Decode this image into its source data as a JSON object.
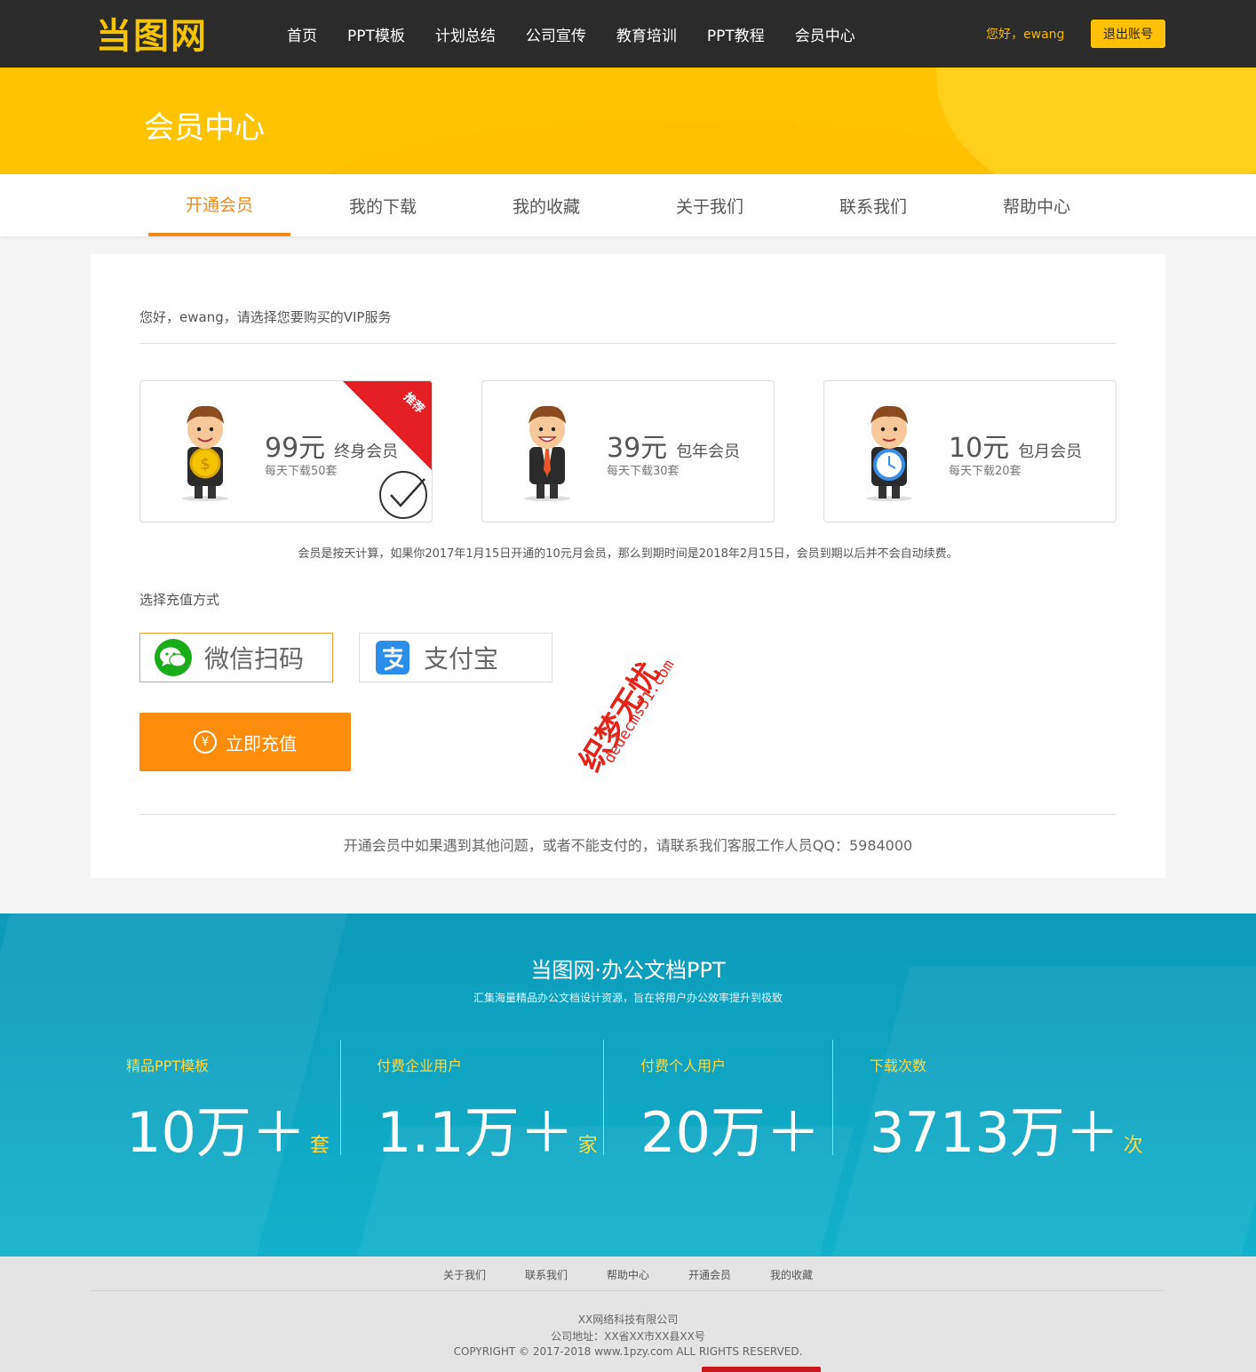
{
  "brand": {
    "logo_text": "当图网",
    "accent": "#f5c400",
    "orange": "#f08b1a"
  },
  "nav": {
    "items": [
      "首页",
      "PPT模板",
      "计划总结",
      "公司宣传",
      "教育培训",
      "PPT教程",
      "会员中心"
    ],
    "greeting": "您好，ewang",
    "logout": "退出账号"
  },
  "banner": {
    "title": "会员中心"
  },
  "tabs": [
    "开通会员",
    "我的下载",
    "我的收藏",
    "关于我们",
    "联系我们",
    "帮助中心"
  ],
  "main": {
    "hello": "您好，ewang，请选择您要购买的VIP服务",
    "plans": [
      {
        "price": "99元",
        "type": "终身会员",
        "desc": "每天下载50套",
        "ribbon": "推荐",
        "selected": true,
        "icon": "coin-mascot-icon"
      },
      {
        "price": "39元",
        "type": "包年会员",
        "desc": "每天下载30套",
        "icon": "tie-mascot-icon"
      },
      {
        "price": "10元",
        "type": "包月会员",
        "desc": "每天下载20套",
        "icon": "clock-mascot-icon"
      }
    ],
    "note": "会员是按天计算，如果你2017年1月15日开通的10元月会员，那么到期时间是2018年2月15日，会员到期以后并不会自动续费。",
    "pay_label": "选择充值方式",
    "pay_methods": [
      {
        "label": "微信扫码",
        "icon": "wechat-icon",
        "selected": true
      },
      {
        "label": "支付宝",
        "icon": "alipay-icon"
      }
    ],
    "recharge": "立即充值",
    "recharge_symbol": "¥",
    "contact": "开通会员中如果遇到其他问题，或者不能支付的，请联系我们客服工作人员QQ：5984000",
    "watermark": {
      "cn": "织梦无忧",
      "url": "dedecms51.com"
    }
  },
  "stats": {
    "title": "当图网·办公文档PPT",
    "subtitle": "汇集海量精品办公文档设计资源，旨在将用户办公效率提升到极致",
    "items": [
      {
        "label": "精品PPT模板",
        "value": "10万＋",
        "unit": "套"
      },
      {
        "label": "付费企业用户",
        "value": "1.1万＋",
        "unit": "家"
      },
      {
        "label": "付费个人用户",
        "value": "20万＋",
        "unit": ""
      },
      {
        "label": "下载次数",
        "value": "3713万＋",
        "unit": "次"
      }
    ]
  },
  "footer": {
    "links": [
      "关于我们",
      "联系我们",
      "帮助中心",
      "开通会员",
      "我的收藏"
    ],
    "company": "XX网络科技有限公司",
    "address": "公司地址：XX省XX市XX县XX号",
    "copyright": "COPYRIGHT © 2017-2018 www.1pzy.com ALL RIGHTS RESERVED."
  }
}
